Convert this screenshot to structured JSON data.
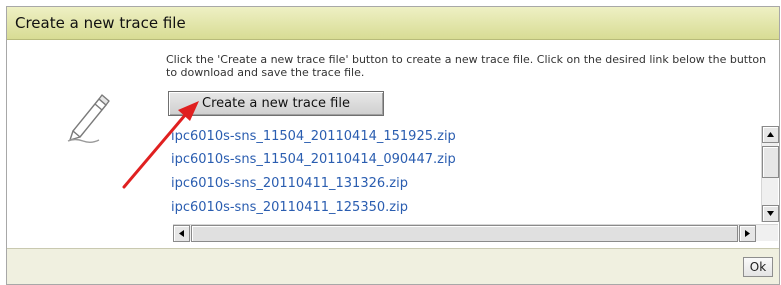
{
  "dialog": {
    "title": "Create a new trace file",
    "instructions": "Click the 'Create a new trace file' button to create a new trace file. Click on the desired link below the button to download and save the trace file.",
    "create_button_label": "Create a new trace file",
    "trace_files": [
      "ipc6010s-sns_11504_20110414_151925.zip",
      "ipc6010s-sns_11504_20110414_090447.zip",
      "ipc6010s-sns_20110411_131326.zip",
      "ipc6010s-sns_20110411_125350.zip"
    ],
    "ok_label": "Ok"
  },
  "icons": {
    "edit": "pencil-icon",
    "annotation": "red-arrow"
  },
  "colors": {
    "title_bar": "#d8dc94",
    "link": "#2a5db0",
    "annotation_arrow": "#e02020",
    "footer": "#f0f0e0"
  }
}
